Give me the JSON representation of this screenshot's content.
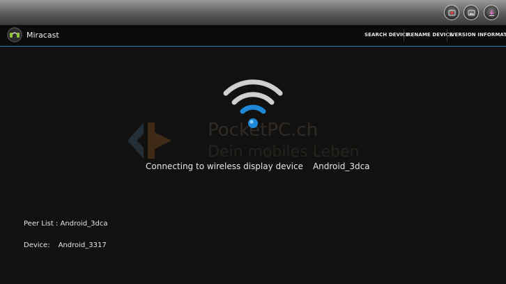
{
  "app": {
    "title": "Miracast"
  },
  "menu": [
    {
      "label": "SEARCH DEVICE"
    },
    {
      "label": "RENAME DEVICE"
    },
    {
      "label": "VERSION INFORMATION"
    }
  ],
  "system_buttons": [
    "record-icon",
    "gallery-icon",
    "download-icon"
  ],
  "watermark": {
    "line1": "PocketPC.ch",
    "line2": "Dein mobiles Leben"
  },
  "status": {
    "text": "Connecting to wireless display device",
    "device": "Android_3dca"
  },
  "peer_list": {
    "label": "Peer List :",
    "value": "Android_3dca"
  },
  "device": {
    "label": "Device:",
    "value": "Android_3317"
  },
  "colors": {
    "accent": "#2d7fb2",
    "wifi_active": "#1e88d6",
    "wifi_inactive": "#cfcfcf"
  }
}
